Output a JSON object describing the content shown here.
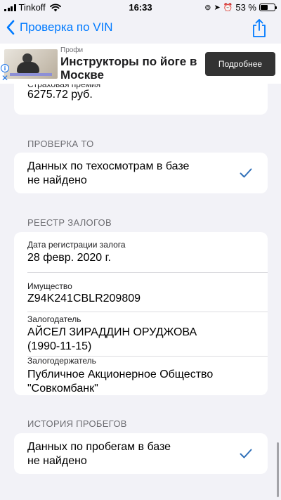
{
  "status_bar": {
    "carrier": "Tinkoff",
    "time": "16:33",
    "battery": "53 %",
    "battery_level": 0.53,
    "icons": [
      "signal-icon",
      "wifi-icon",
      "screen-rotation-lock-icon",
      "location-icon",
      "alarm-icon",
      "battery-icon"
    ]
  },
  "nav": {
    "back_label": "Проверка по VIN",
    "share_icon": "share-icon"
  },
  "ad": {
    "brand": "Профи",
    "headline": "Инструкторы по йоге в Москве",
    "button_label": "Подробнее",
    "info_icon": "i",
    "close_icon": "✕"
  },
  "insurance": {
    "partial_label": "Страховая премия",
    "value": "6275.72 руб."
  },
  "inspection": {
    "header": "ПРОВЕРКА ТО",
    "text_line1": "Данных по техосмотрам в базе",
    "text_line2": "не найдено"
  },
  "pledges": {
    "header": "РЕЕСТР ЗАЛОГОВ",
    "fields": [
      {
        "label": "Дата регистрации залога",
        "value_line1": "28 февр. 2020 г.",
        "value_line2": ""
      },
      {
        "label": "Имущество",
        "value_line1": "Z94K241CBLR209809",
        "value_line2": ""
      },
      {
        "label": "Залогодатель",
        "value_line1": "АЙСЕЛ ЗИРАДДИН ОРУДЖОВА",
        "value_line2": "(1990-11-15)"
      },
      {
        "label": "Залогодержатель",
        "value_line1": "Публичное Акционерное Общество",
        "value_line2": "\"Совкомбанк\""
      }
    ]
  },
  "mileage": {
    "header": "ИСТОРИЯ ПРОБЕГОВ",
    "text_line1": "Данных по пробегам в базе",
    "text_line2": "не найдено"
  },
  "colors": {
    "accent": "#007aff",
    "checkmark": "#2f6fb8",
    "background": "#f2f2f7",
    "card": "#ffffff",
    "secondary_text": "#6d6d72"
  }
}
